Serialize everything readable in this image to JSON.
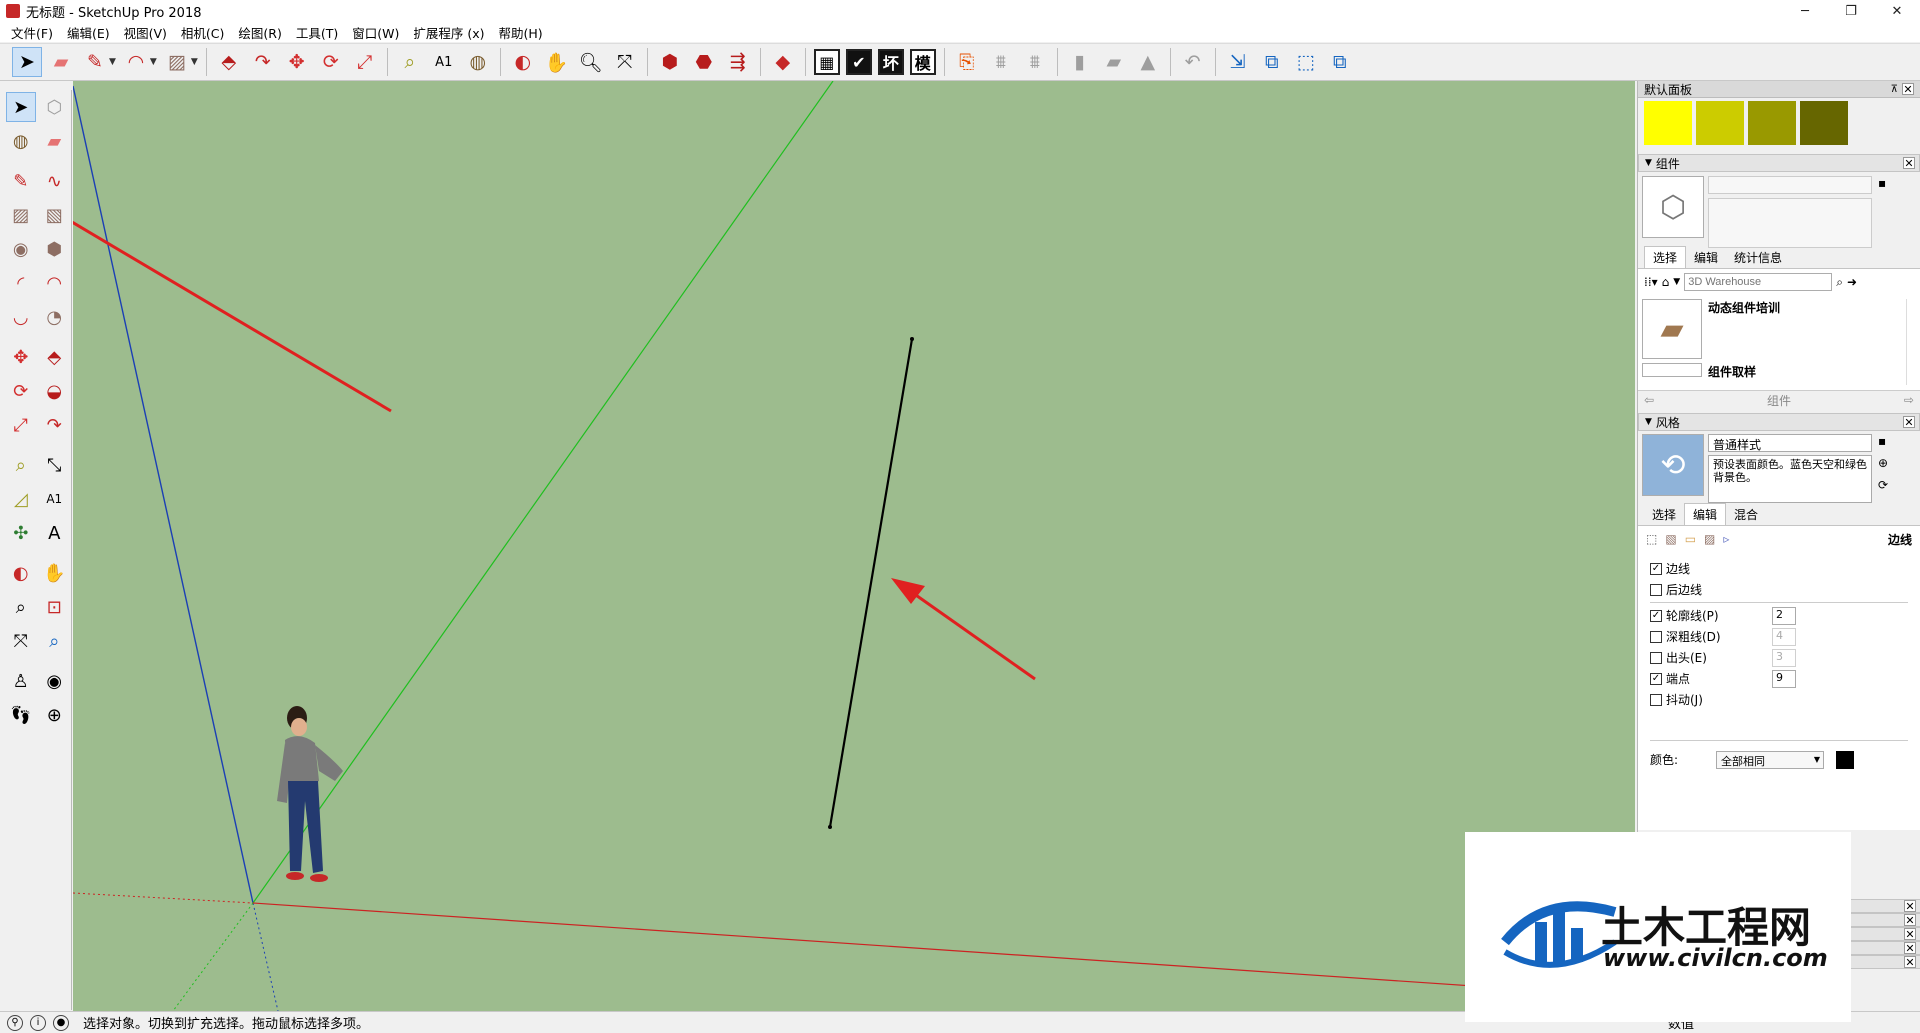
{
  "window": {
    "title": "无标题 - SketchUp Pro 2018",
    "minimize": "─",
    "maximize": "❐",
    "close": "✕"
  },
  "menu": [
    "文件(F)",
    "编辑(E)",
    "视图(V)",
    "相机(C)",
    "绘图(R)",
    "工具(T)",
    "窗口(W)",
    "扩展程序 (x)",
    "帮助(H)"
  ],
  "toolbar": {
    "text_buttons": [
      "坏",
      "模"
    ]
  },
  "tray": {
    "title": "默认面板",
    "swatches": [
      "#ffff00",
      "#cccc00",
      "#999900",
      "#666600"
    ],
    "components": {
      "header": "组件",
      "tabs": [
        "选择",
        "编辑",
        "统计信息"
      ],
      "search_placeholder": "3D Warehouse",
      "items": [
        "动态组件培训",
        "组件取样"
      ],
      "footer": "组件"
    },
    "styles": {
      "header": "风格",
      "style_name": "普通样式",
      "style_desc": "预设表面颜色。蓝色天空和绿色背景色。",
      "tabs": [
        "选择",
        "编辑",
        "混合"
      ],
      "section_label": "边线",
      "options": [
        {
          "label": "边线",
          "checked": true,
          "value": ""
        },
        {
          "label": "后边线",
          "checked": false,
          "value": ""
        },
        {
          "label": "轮廓线(P)",
          "checked": true,
          "value": "2"
        },
        {
          "label": "深粗线(D)",
          "checked": false,
          "value": "4"
        },
        {
          "label": "出头(E)",
          "checked": false,
          "value": "3"
        },
        {
          "label": "端点",
          "checked": true,
          "value": "9"
        },
        {
          "label": "抖动(J)",
          "checked": false,
          "value": ""
        }
      ],
      "color_label": "颜色:",
      "color_select": "全部相同",
      "color_value": "#000000"
    }
  },
  "status": {
    "message": "选择对象。切换到扩充选择。拖动鼠标选择多项。",
    "measure_label": "数值"
  },
  "watermark": {
    "name": "土木工程网",
    "url": "www.civilcn.com"
  }
}
